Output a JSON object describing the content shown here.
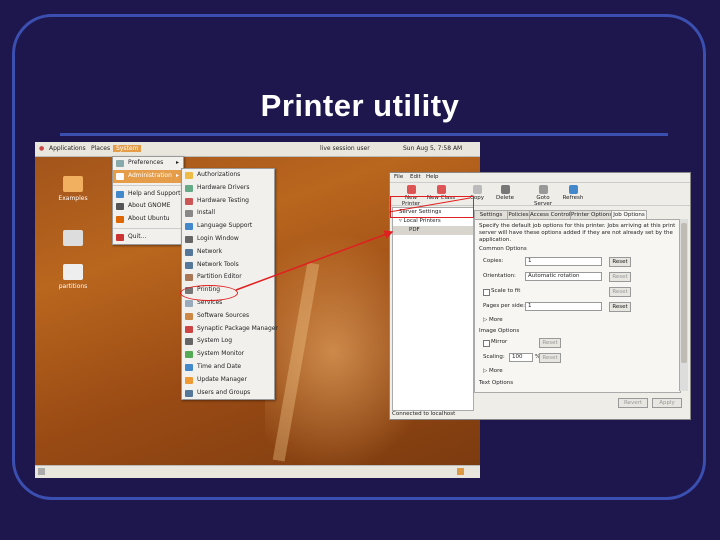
{
  "slide": {
    "title": "Printer utility"
  },
  "top_panel": {
    "applications": "Applications",
    "places": "Places",
    "system": "System",
    "session_user": "live session user",
    "clock": "Sun Aug 5, 7:58 AM"
  },
  "desktop_icons": [
    {
      "label": "Examples"
    },
    {
      "label": ""
    },
    {
      "label": "partitions"
    }
  ],
  "system_menu": {
    "items": [
      "Preferences",
      "Administration",
      "Help and Support",
      "About GNOME",
      "About Ubuntu",
      "Quit..."
    ]
  },
  "admin_menu": {
    "items": [
      "Authorizations",
      "Hardware Drivers",
      "Hardware Testing",
      "Install",
      "Language Support",
      "Login Window",
      "Network",
      "Network Tools",
      "Partition Editor",
      "Printing",
      "Services",
      "Software Sources",
      "Synaptic Package Manager",
      "System Log",
      "System Monitor",
      "Time and Date",
      "Update Manager",
      "Users and Groups"
    ],
    "highlighted": "Printing"
  },
  "printer_window": {
    "menubar": [
      "File",
      "Edit",
      "Help"
    ],
    "toolbar": [
      "New Printer",
      "New Class",
      "Copy",
      "Delete",
      "Goto Server",
      "Refresh"
    ],
    "tree": [
      "Server Settings",
      "Local Printers",
      "PDF"
    ],
    "tabs": [
      "Settings",
      "Policies",
      "Access Control",
      "Printer Options",
      "Job Options"
    ],
    "description": [
      "Specify the default job options for this printer. Jobs arriving at this print",
      "server will have these options added if they are not already set by the",
      "application."
    ],
    "common_options_header": "Common Options",
    "copies_label": "Copies:",
    "copies_value": "1",
    "orientation_label": "Orientation:",
    "orientation_value": "Automatic rotation",
    "scale_to_fit": "Scale to fit",
    "pages_per_side_label": "Pages per side:",
    "pages_per_side_value": "1",
    "more_1": "More",
    "image_options_header": "Image Options",
    "mirror": "Mirror",
    "scaling_label": "Scaling:",
    "scaling_value": "100",
    "scaling_unit": "%",
    "more_2": "More",
    "text_options_header": "Text Options",
    "reset": "Reset",
    "apply": "Apply",
    "revert": "Revert",
    "status": "Connected to localhost"
  }
}
